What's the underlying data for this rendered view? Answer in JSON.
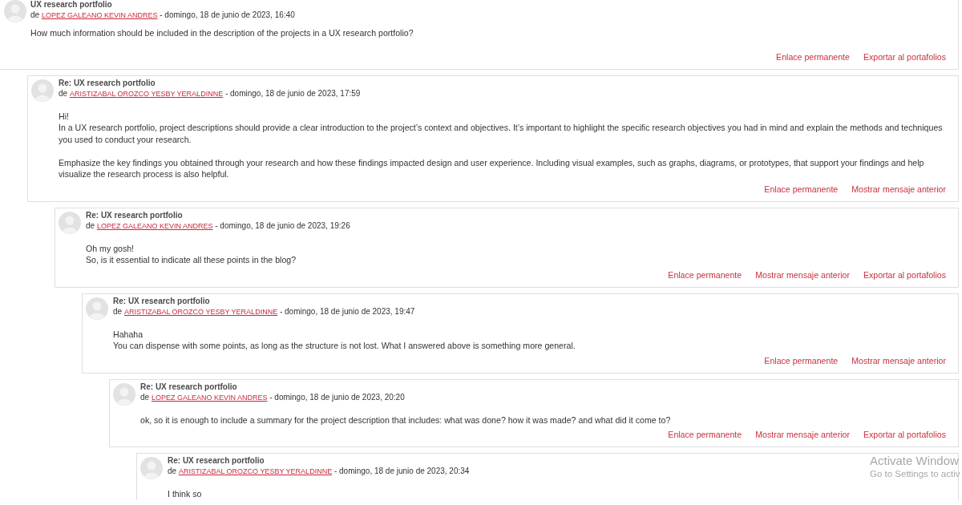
{
  "discussion": {
    "post": {
      "title": "UX research portfolio",
      "by": "de",
      "author": "LOPEZ GALEANO KEVIN ANDRES",
      "date": "- domingo, 18 de junio de 2023, 16:40",
      "paragraphs": [
        [
          "How much information should be included in the description of the projects in a UX research portfolio?"
        ]
      ],
      "actions": [
        "Enlace permanente",
        "Exportar al portafolios"
      ],
      "children": [
        {
          "title": "Re: UX research portfolio",
          "by": "de",
          "author": "ARISTIZABAL OROZCO YESBY YERALDINNE",
          "date": "- domingo, 18 de junio de 2023, 17:59",
          "paragraphs": [
            [
              "Hi!",
              "In a UX research portfolio, project descriptions should provide a clear introduction to the project’s context and objectives. It’s important to highlight the specific research objectives you had in mind and explain the methods and techniques you used to conduct your research."
            ],
            [
              "Emphasize the key findings you obtained through your research and how these findings impacted design and user experience. Including visual examples, such as graphs, diagrams, or prototypes, that support your findings and help visualize the research process is also helpful."
            ]
          ],
          "actions": [
            "Enlace permanente",
            "Mostrar mensaje anterior"
          ],
          "children": [
            {
              "title": "Re: UX research portfolio",
              "by": "de",
              "author": "LOPEZ GALEANO KEVIN ANDRES",
              "date": "- domingo, 18 de junio de 2023, 19:26",
              "paragraphs": [
                [
                  "Oh my gosh!",
                  "So, is it essential to indicate all these points in the blog?"
                ]
              ],
              "actions": [
                "Enlace permanente",
                "Mostrar mensaje anterior",
                "Exportar al portafolios"
              ],
              "children": [
                {
                  "title": "Re: UX research portfolio",
                  "by": "de",
                  "author": "ARISTIZABAL OROZCO YESBY YERALDINNE",
                  "date": "- domingo, 18 de junio de 2023, 19:47",
                  "paragraphs": [
                    [
                      "Hahaha",
                      "You can dispense with some points, as long as the structure is not lost. What I answered above is something more general."
                    ]
                  ],
                  "actions": [
                    "Enlace permanente",
                    "Mostrar mensaje anterior"
                  ],
                  "children": [
                    {
                      "title": "Re: UX research portfolio",
                      "by": "de",
                      "author": "LOPEZ GALEANO KEVIN ANDRES",
                      "date": "- domingo, 18 de junio de 2023, 20:20",
                      "paragraphs": [
                        [
                          "ok, so it is enough to include a summary for the project description that includes: what was done? how it was made? and what did it come to?"
                        ]
                      ],
                      "actions": [
                        "Enlace permanente",
                        "Mostrar mensaje anterior",
                        "Exportar al portafolios"
                      ],
                      "children": [
                        {
                          "title": "Re: UX research portfolio",
                          "by": "de",
                          "author": "ARISTIZABAL OROZCO YESBY YERALDINNE",
                          "date": "- domingo, 18 de junio de 2023, 20:34",
                          "paragraphs": [
                            [
                              "I think so"
                            ]
                          ]
                        }
                      ]
                    }
                  ]
                }
              ]
            }
          ]
        }
      ]
    }
  },
  "os_overlay": {
    "title": "Activate Window",
    "text": "Go to Settings to activ"
  }
}
